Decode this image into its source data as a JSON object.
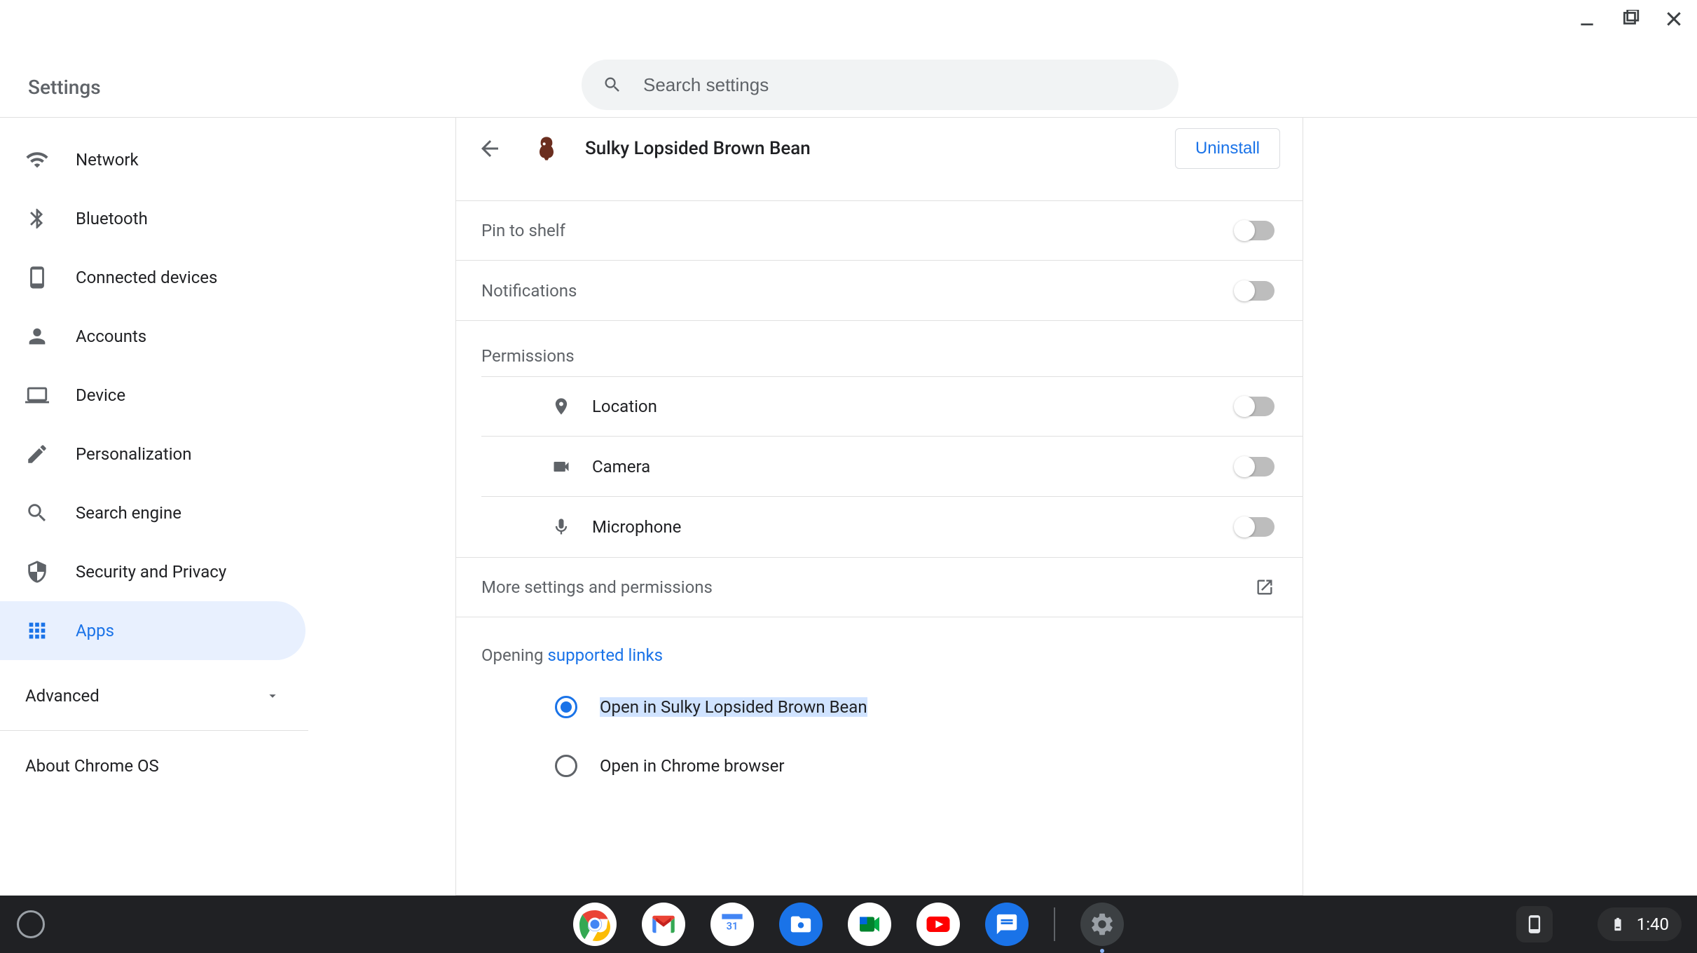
{
  "window": {
    "title": "Settings"
  },
  "search": {
    "placeholder": "Search settings"
  },
  "sidebar": {
    "items": [
      {
        "label": "Network"
      },
      {
        "label": "Bluetooth"
      },
      {
        "label": "Connected devices"
      },
      {
        "label": "Accounts"
      },
      {
        "label": "Device"
      },
      {
        "label": "Personalization"
      },
      {
        "label": "Search engine"
      },
      {
        "label": "Security and Privacy"
      },
      {
        "label": "Apps"
      }
    ],
    "advanced": "Advanced",
    "about": "About Chrome OS"
  },
  "detail": {
    "app_name": "Sulky Lopsided Brown Bean",
    "uninstall": "Uninstall",
    "pin_to_shelf": "Pin to shelf",
    "notifications": "Notifications",
    "permissions_header": "Permissions",
    "permissions": {
      "location": "Location",
      "camera": "Camera",
      "microphone": "Microphone"
    },
    "more_settings": "More settings and permissions",
    "opening_prefix": "Opening ",
    "supported_links": "supported links",
    "radio_open_in_app": "Open in Sulky Lopsided Brown Bean",
    "radio_open_in_chrome": "Open in Chrome browser"
  },
  "shelf": {
    "clock": "1:40"
  },
  "colors": {
    "accent": "#1a73e8"
  }
}
